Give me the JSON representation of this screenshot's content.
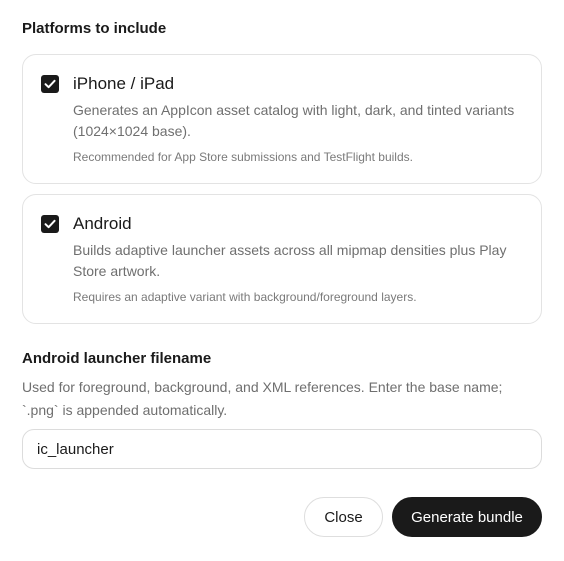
{
  "section": {
    "title": "Platforms to include"
  },
  "platforms": [
    {
      "title": "iPhone / iPad",
      "checked": true,
      "description": "Generates an AppIcon asset catalog with light, dark, and tinted variants (1024×1024 base).",
      "note": "Recommended for App Store submissions and TestFlight builds."
    },
    {
      "title": "Android",
      "checked": true,
      "description": "Builds adaptive launcher assets across all mipmap densities plus Play Store artwork.",
      "note": "Requires an adaptive variant with background/foreground layers."
    }
  ],
  "filename_field": {
    "label": "Android launcher filename",
    "help": "Used for foreground, background, and XML references. Enter the base name; `.png` is appended automatically.",
    "value": "ic_launcher"
  },
  "actions": {
    "close_label": "Close",
    "generate_label": "Generate bundle"
  },
  "colors": {
    "primary": "#1a1a1a",
    "muted_text": "#6f6f6f",
    "border": "#e3e3e3"
  }
}
